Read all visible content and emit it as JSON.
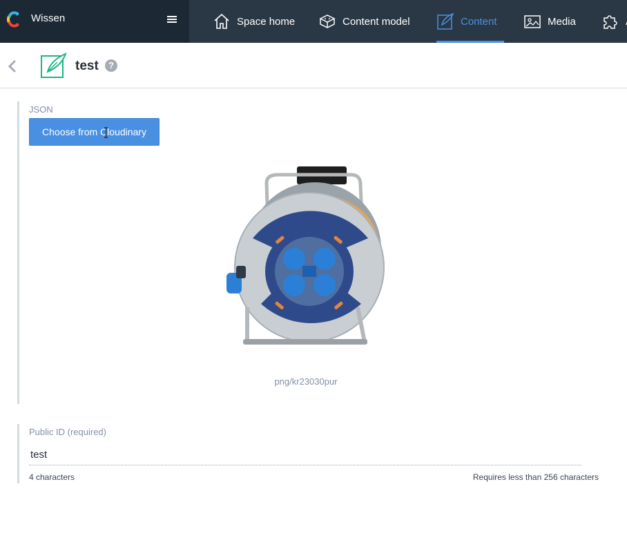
{
  "topbar": {
    "space_name": "Wissen",
    "logo_icon": "contentful-logo",
    "menu_icon": "hamburger-icon",
    "nav": [
      {
        "label": "Space home",
        "icon": "house-icon"
      },
      {
        "label": "Content model",
        "icon": "cube-icon"
      },
      {
        "label": "Content",
        "icon": "pen-icon",
        "active": true
      },
      {
        "label": "Media",
        "icon": "image-icon"
      },
      {
        "label": "A",
        "icon": "puzzle-icon"
      }
    ],
    "colors": {
      "space_bg": "#1c2834",
      "nav_bg": "#2a3845",
      "active": "#4a90e2"
    }
  },
  "entry": {
    "title": "test",
    "help_glyph": "?",
    "icon": "entry-feather-icon"
  },
  "fields": {
    "json": {
      "label": "JSON",
      "button_label": "Choose from Cloudinary",
      "asset_caption": "png/kr23030pur",
      "asset_image": "cable-reel-image"
    },
    "public_id": {
      "label": "Public ID (required)",
      "value": "test",
      "char_count": "4 characters",
      "limit_hint": "Requires less than 256 characters"
    }
  }
}
